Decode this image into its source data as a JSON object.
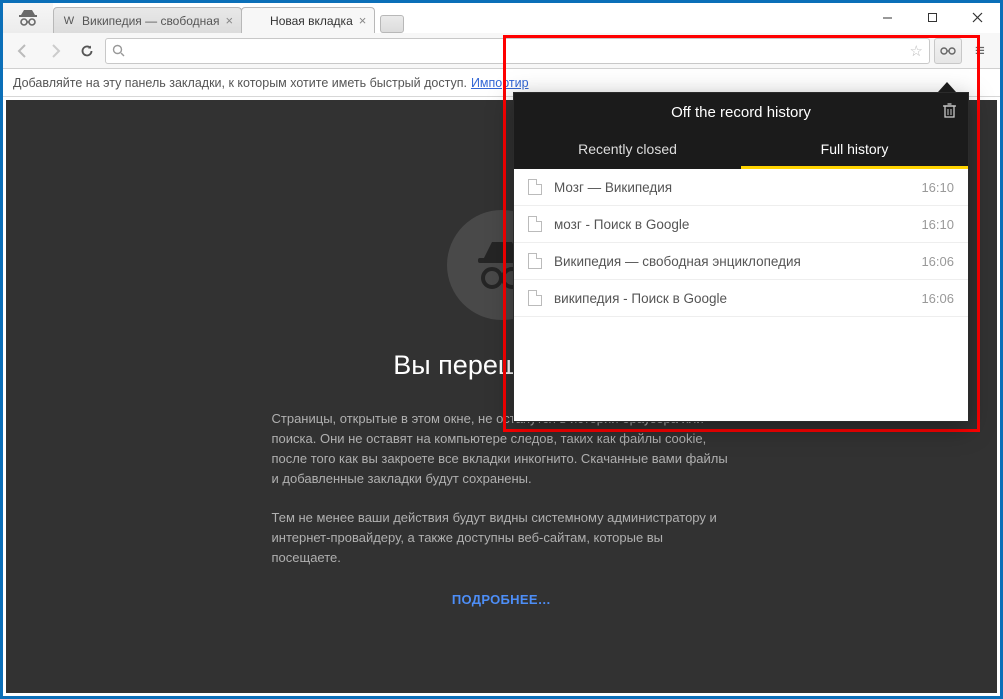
{
  "window": {
    "tabs": [
      {
        "label": "Википедия — свободная",
        "active": false
      },
      {
        "label": "Новая вкладка",
        "active": true
      }
    ]
  },
  "bookmarks_bar": {
    "hint_text": "Добавляйте на эту панель закладки, к которым хотите иметь быстрый доступ.",
    "import_link": "Импортир"
  },
  "incognito": {
    "heading": "Вы перешли в ре",
    "para1": "Страницы, открытые в этом окне, не останутся в истории браузера или поиска. Они не оставят на компьютере следов, таких как файлы cookie, после того как вы закроете все вкладки инкогнито. Скачанные вами файлы и добавленные закладки будут сохранены.",
    "para2": "Тем не менее ваши действия будут видны системному администратору и интернет-провайдеру, а также доступны веб-сайтам, которые вы посещаете.",
    "learn_more": "ПОДРОБНЕЕ…"
  },
  "popup": {
    "title": "Off the record history",
    "tab_recent": "Recently closed",
    "tab_full": "Full history",
    "items": [
      {
        "title": "Мозг — Википедия",
        "time": "16:10"
      },
      {
        "title": "мозг - Поиск в Google",
        "time": "16:10"
      },
      {
        "title": "Википедия — свободная энциклопедия",
        "time": "16:06"
      },
      {
        "title": "википедия - Поиск в Google",
        "time": "16:06"
      }
    ]
  },
  "omnibox": {
    "value": ""
  }
}
